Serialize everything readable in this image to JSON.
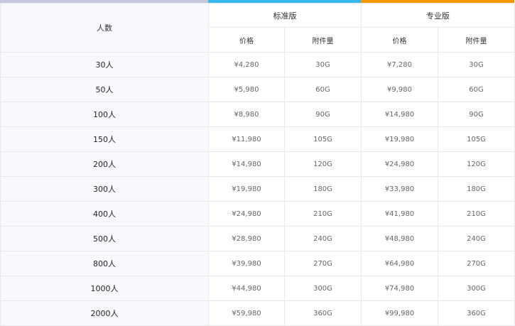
{
  "colors": {
    "bar_people": "#c6c8d9",
    "bar_standard": "#35b8f0",
    "bar_pro": "#f39800"
  },
  "header": {
    "people_label": "人数",
    "standard_label": "标准版",
    "pro_label": "专业版",
    "price_label": "价格",
    "storage_label": "附件量"
  },
  "rows": [
    {
      "people": "30人",
      "std_price": "¥4,280",
      "std_storage": "30G",
      "pro_price": "¥7,280",
      "pro_storage": "30G"
    },
    {
      "people": "50人",
      "std_price": "¥5,980",
      "std_storage": "60G",
      "pro_price": "¥9,980",
      "pro_storage": "60G"
    },
    {
      "people": "100人",
      "std_price": "¥8,980",
      "std_storage": "90G",
      "pro_price": "¥14,980",
      "pro_storage": "90G"
    },
    {
      "people": "150人",
      "std_price": "¥11,980",
      "std_storage": "105G",
      "pro_price": "¥19,980",
      "pro_storage": "105G"
    },
    {
      "people": "200人",
      "std_price": "¥14,980",
      "std_storage": "120G",
      "pro_price": "¥24,980",
      "pro_storage": "120G"
    },
    {
      "people": "300人",
      "std_price": "¥19,980",
      "std_storage": "180G",
      "pro_price": "¥33,980",
      "pro_storage": "180G"
    },
    {
      "people": "400人",
      "std_price": "¥24,980",
      "std_storage": "210G",
      "pro_price": "¥41,980",
      "pro_storage": "210G"
    },
    {
      "people": "500人",
      "std_price": "¥28,980",
      "std_storage": "240G",
      "pro_price": "¥48,980",
      "pro_storage": "240G"
    },
    {
      "people": "800人",
      "std_price": "¥39,980",
      "std_storage": "270G",
      "pro_price": "¥64,980",
      "pro_storage": "270G"
    },
    {
      "people": "1000人",
      "std_price": "¥44,980",
      "std_storage": "300G",
      "pro_price": "¥74,980",
      "pro_storage": "300G"
    },
    {
      "people": "2000人",
      "std_price": "¥59,980",
      "std_storage": "360G",
      "pro_price": "¥99,980",
      "pro_storage": "360G"
    }
  ]
}
